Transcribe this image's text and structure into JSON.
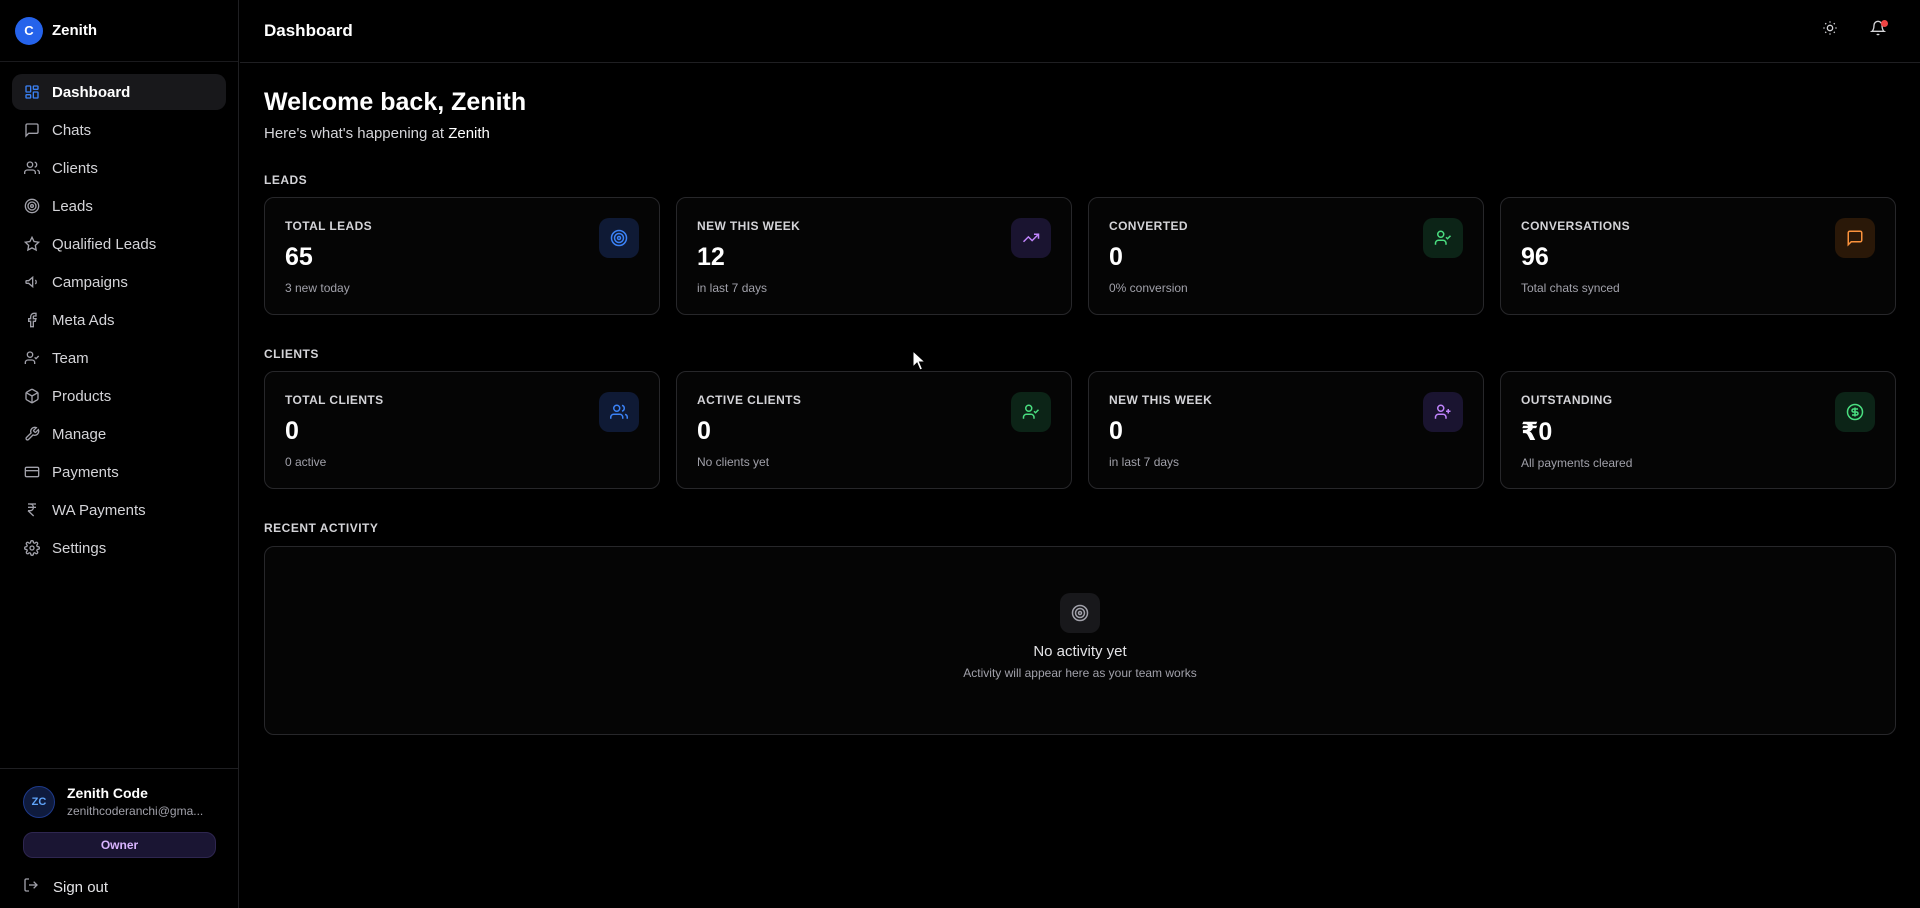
{
  "brand": {
    "logo_letter": "C",
    "name": "Zenith"
  },
  "nav": [
    {
      "label": "Dashboard",
      "icon": "grid-icon",
      "active": true
    },
    {
      "label": "Chats",
      "icon": "message-square-icon"
    },
    {
      "label": "Clients",
      "icon": "users-icon"
    },
    {
      "label": "Leads",
      "icon": "target-icon"
    },
    {
      "label": "Qualified Leads",
      "icon": "star-icon"
    },
    {
      "label": "Campaigns",
      "icon": "megaphone-icon"
    },
    {
      "label": "Meta Ads",
      "icon": "facebook-icon"
    },
    {
      "label": "Team",
      "icon": "user-check-icon"
    },
    {
      "label": "Products",
      "icon": "package-icon"
    },
    {
      "label": "Manage",
      "icon": "wrench-icon"
    },
    {
      "label": "Payments",
      "icon": "credit-card-icon"
    },
    {
      "label": "WA Payments",
      "icon": "rupee-icon"
    },
    {
      "label": "Settings",
      "icon": "gear-icon"
    }
  ],
  "user": {
    "initials": "ZC",
    "name": "Zenith Code",
    "email": "zenithcoderanchi@gma...",
    "role": "Owner",
    "signout_label": "Sign out"
  },
  "header": {
    "title": "Dashboard"
  },
  "welcome": {
    "title": "Welcome back, Zenith",
    "sub_prefix": "Here's what's happening at",
    "org": "Zenith"
  },
  "leads": {
    "section_label": "LEADS",
    "cards": [
      {
        "label": "TOTAL LEADS",
        "value": "65",
        "sub": "3 new today",
        "icon": "target-icon",
        "color": "#3b82f6",
        "bg": "#0f1a35"
      },
      {
        "label": "NEW THIS WEEK",
        "value": "12",
        "sub": "in last 7 days",
        "icon": "trending-up-icon",
        "color": "#c084fc",
        "bg": "#1a1430"
      },
      {
        "label": "CONVERTED",
        "value": "0",
        "sub": "0% conversion",
        "icon": "user-check-icon",
        "color": "#4ade80",
        "bg": "#0c2417"
      },
      {
        "label": "CONVERSATIONS",
        "value": "96",
        "sub": "Total chats synced",
        "icon": "message-square-icon",
        "color": "#fb923c",
        "bg": "#2a1808"
      }
    ]
  },
  "clients": {
    "section_label": "CLIENTS",
    "cards": [
      {
        "label": "TOTAL CLIENTS",
        "value": "0",
        "sub": "0 active",
        "icon": "users-icon",
        "color": "#3b82f6",
        "bg": "#0f1a35"
      },
      {
        "label": "ACTIVE CLIENTS",
        "value": "0",
        "sub": "No clients yet",
        "icon": "user-check-icon",
        "color": "#4ade80",
        "bg": "#0c2417"
      },
      {
        "label": "NEW THIS WEEK",
        "value": "0",
        "sub": "in last 7 days",
        "icon": "user-plus-icon",
        "color": "#c084fc",
        "bg": "#1a1430"
      },
      {
        "label": "OUTSTANDING",
        "value": "₹0",
        "sub": "All payments cleared",
        "icon": "dollar-circle-icon",
        "color": "#4ade80",
        "bg": "#0c2417"
      }
    ]
  },
  "activity": {
    "section_label": "RECENT ACTIVITY",
    "empty_title": "No activity yet",
    "empty_sub": "Activity will appear here as your team works"
  }
}
